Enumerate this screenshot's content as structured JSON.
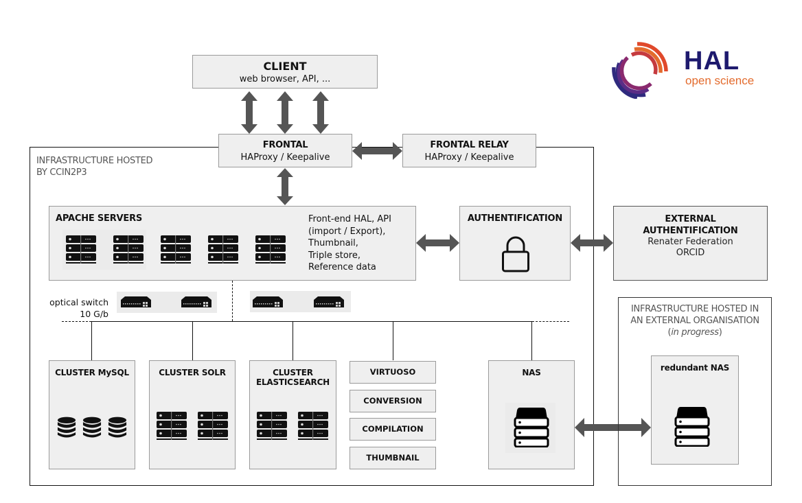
{
  "logo": {
    "name": "HAL",
    "tagline": "open science",
    "colors": {
      "dark": "#2f2a7e",
      "purple": "#8a2a6e",
      "red": "#e0492b",
      "orange": "#e36b2d"
    }
  },
  "client": {
    "title": "CLIENT",
    "subtitle": "web browser, API, ..."
  },
  "frontal": {
    "title": "FRONTAL",
    "subtitle": "HAProxy / Keepalive"
  },
  "frontal_relay": {
    "title": "FRONTAL RELAY",
    "subtitle": "HAProxy / Keepalive"
  },
  "internal_infra": {
    "label_line1": "INFRASTRUCTURE HOSTED",
    "label_line2": "BY CCIN2P3"
  },
  "apache": {
    "title": "APACHE SERVERS",
    "server_count": 5,
    "description": [
      "Front-end HAL, API",
      "(import / Export),",
      "Thumbnail,",
      "Triple store,",
      "Reference data"
    ]
  },
  "authentification": {
    "title": "AUTHENTIFICATION",
    "icon": "lock-icon"
  },
  "external_auth": {
    "title_line1": "EXTERNAL",
    "title_line2": "AUTHENTIFICATION",
    "providers": [
      "Renater Federation",
      "ORCID"
    ]
  },
  "optical_switch": {
    "label_line1": "optical switch",
    "label_line2": "10 G/b",
    "switch_count": 4
  },
  "clusters": [
    {
      "title": "CLUSTER MySQL",
      "icon": "database-icon",
      "count": 3
    },
    {
      "title": "CLUSTER SOLR",
      "icon": "server-icon",
      "count": 2
    },
    {
      "title_line1": "CLUSTER",
      "title_line2": "ELASTICSEARCH",
      "icon": "server-icon",
      "count": 2
    }
  ],
  "services": [
    "VIRTUOSO",
    "CONVERSION",
    "COMPILATION",
    "THUMBNAIL"
  ],
  "nas": {
    "title": "NAS",
    "icon": "nas-icon"
  },
  "external_infra": {
    "label_line1": "INFRASTRUCTURE HOSTED IN",
    "label_line2": "AN EXTERNAL ORGANISATION",
    "label_line3_open": "(",
    "label_line3_italic": "in progress",
    "label_line3_close": ")",
    "redundant_nas": {
      "title": "redundant NAS",
      "icon": "nas-icon"
    }
  },
  "colors": {
    "arrow": "#555555",
    "box_fill": "#efefef",
    "box_border": "#9a9a9a",
    "frame": "#111111"
  }
}
